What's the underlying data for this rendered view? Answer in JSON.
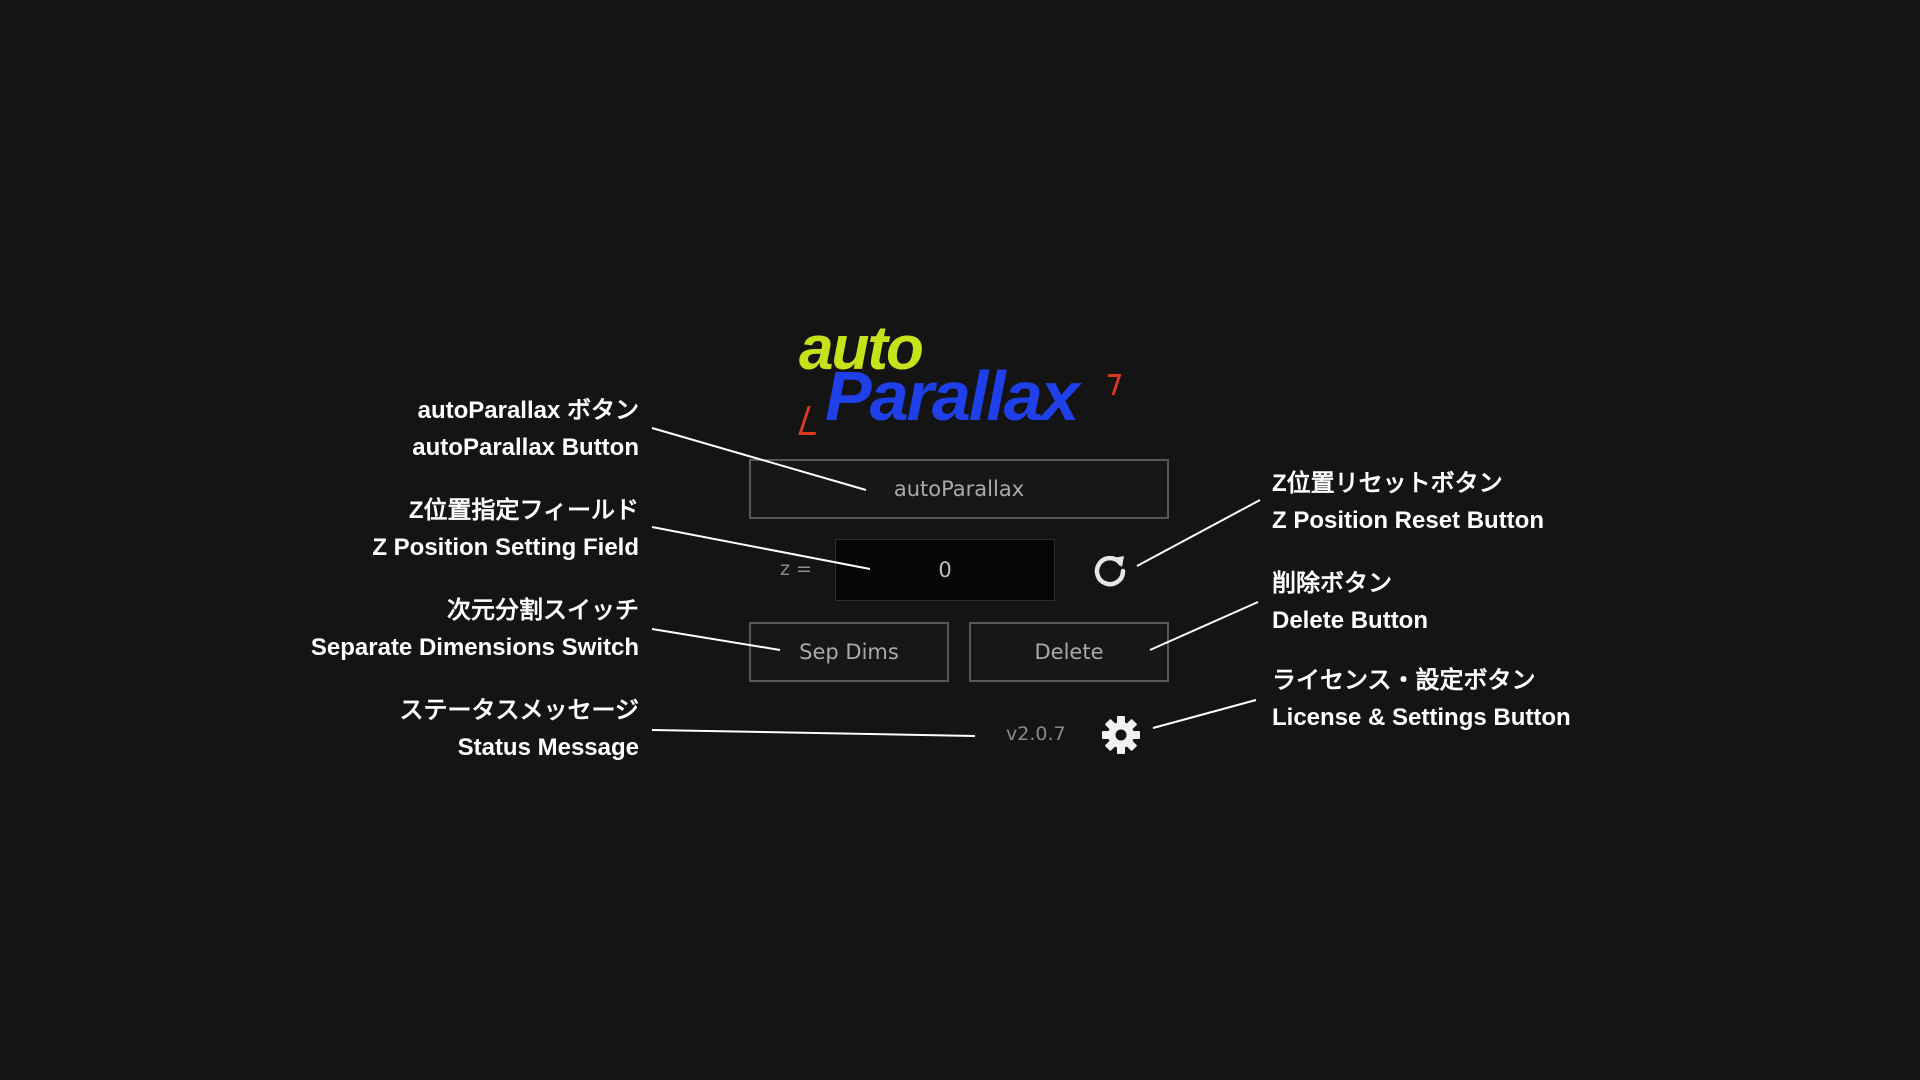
{
  "logo": {
    "auto_text": "auto",
    "parallax_text": "Parallax",
    "colors": {
      "auto": "#c6e21a",
      "parallax": "#1f3fe8",
      "bracket": "#d83a1f"
    }
  },
  "panel": {
    "autoparallax_button_label": "autoParallax",
    "z_label": "z =",
    "z_value": "0",
    "reset_icon": "refresh-icon",
    "sepdims_button_label": "Sep Dims",
    "delete_button_label": "Delete",
    "status_message": "v2.0.7",
    "settings_icon": "gear-icon"
  },
  "annotations": {
    "autoparallax_button": {
      "ja": "autoParallax ボタン",
      "en": "autoParallax Button"
    },
    "z_position_field": {
      "ja": "Z位置指定フィールド",
      "en": "Z Position Setting Field"
    },
    "separate_dimensions_switch": {
      "ja": "次元分割スイッチ",
      "en": "Separate Dimensions Switch"
    },
    "status_message": {
      "ja": "ステータスメッセージ",
      "en": "Status Message"
    },
    "z_position_reset_button": {
      "ja": "Z位置リセットボタン",
      "en": "Z Position Reset Button"
    },
    "delete_button": {
      "ja": "削除ボタン",
      "en": "Delete Button"
    },
    "license_settings_button": {
      "ja": "ライセンス・設定ボタン",
      "en": "License & Settings Button"
    }
  },
  "colors": {
    "background": "#141414",
    "button_border": "#585858",
    "annotation_text": "#ffffff"
  }
}
